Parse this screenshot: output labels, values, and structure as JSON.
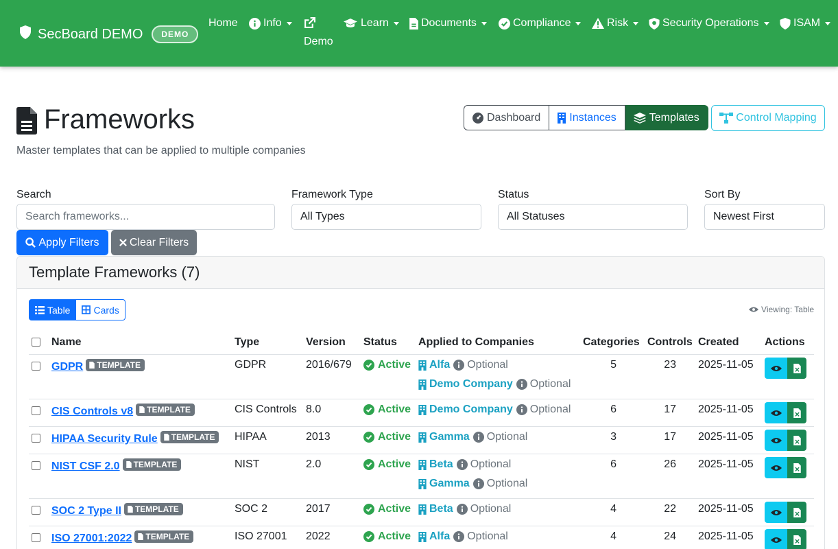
{
  "navbar": {
    "brand": "SecBoard DEMO",
    "badge": "DEMO",
    "items": [
      {
        "label": "Home",
        "icon": "none"
      },
      {
        "label": "Info",
        "icon": "info-circle-icon"
      },
      {
        "label": "Demo",
        "icon": "external-link-icon"
      },
      {
        "label": "Learn",
        "icon": "graduation-cap-icon"
      },
      {
        "label": "Documents",
        "icon": "file-icon"
      },
      {
        "label": "Compliance",
        "icon": "check-circle-icon"
      },
      {
        "label": "Risk",
        "icon": "warning-triangle-icon"
      },
      {
        "label": "Security Operations",
        "icon": "shield-virus-icon"
      },
      {
        "label": "ISAM",
        "icon": "shield-icon"
      }
    ]
  },
  "header": {
    "title": "Frameworks",
    "subtitle": "Master templates that can be applied to multiple companies",
    "view_buttons": {
      "dashboard": "Dashboard",
      "instances": "Instances",
      "templates": "Templates"
    },
    "control_mapping": "Control Mapping"
  },
  "filters": {
    "search_label": "Search",
    "search_placeholder": "Search frameworks...",
    "type_label": "Framework Type",
    "type_value": "All Types",
    "status_label": "Status",
    "status_value": "All Statuses",
    "sort_label": "Sort By",
    "sort_value": "Newest First",
    "apply": "Apply Filters",
    "clear": "Clear Filters"
  },
  "card": {
    "title": "Template Frameworks (7)",
    "view_table": "Table",
    "view_cards": "Cards",
    "viewing": "Viewing: Table"
  },
  "table": {
    "columns": [
      "Name",
      "Type",
      "Version",
      "Status",
      "Applied to Companies",
      "Categories",
      "Controls",
      "Created",
      "Actions"
    ],
    "badge": "TEMPLATE",
    "rows": [
      {
        "name": "GDPR",
        "type": "GDPR",
        "version": "2016/679",
        "status": "Active",
        "companies": [
          {
            "name": "Alfa",
            "mode": "Optional"
          },
          {
            "name": "Demo Company",
            "mode": "Optional"
          }
        ],
        "categories": "5",
        "controls": "23",
        "created": "2025-11-05"
      },
      {
        "name": "CIS Controls v8",
        "type": "CIS Controls",
        "version": "8.0",
        "status": "Active",
        "companies": [
          {
            "name": "Demo Company",
            "mode": "Optional"
          }
        ],
        "categories": "6",
        "controls": "17",
        "created": "2025-11-05"
      },
      {
        "name": "HIPAA Security Rule",
        "type": "HIPAA",
        "version": "2013",
        "status": "Active",
        "companies": [
          {
            "name": "Gamma",
            "mode": "Optional"
          }
        ],
        "categories": "3",
        "controls": "17",
        "created": "2025-11-05"
      },
      {
        "name": "NIST CSF 2.0",
        "type": "NIST",
        "version": "2.0",
        "status": "Active",
        "companies": [
          {
            "name": "Beta",
            "mode": "Optional"
          },
          {
            "name": "Gamma",
            "mode": "Optional"
          }
        ],
        "categories": "6",
        "controls": "26",
        "created": "2025-11-05"
      },
      {
        "name": "SOC 2 Type II",
        "type": "SOC 2",
        "version": "2017",
        "status": "Active",
        "companies": [
          {
            "name": "Beta",
            "mode": "Optional"
          }
        ],
        "categories": "4",
        "controls": "22",
        "created": "2025-11-05"
      },
      {
        "name": "ISO 27001:2022",
        "type": "ISO 27001",
        "version": "2022",
        "status": "Active",
        "companies": [
          {
            "name": "Alfa",
            "mode": "Optional"
          }
        ],
        "categories": "4",
        "controls": "24",
        "created": "2025-11-05"
      }
    ]
  },
  "colors": {
    "navbar": "#2ea44f",
    "primary": "#0d6efd",
    "active": "#2ea44f",
    "company": "#1ba1c2"
  }
}
